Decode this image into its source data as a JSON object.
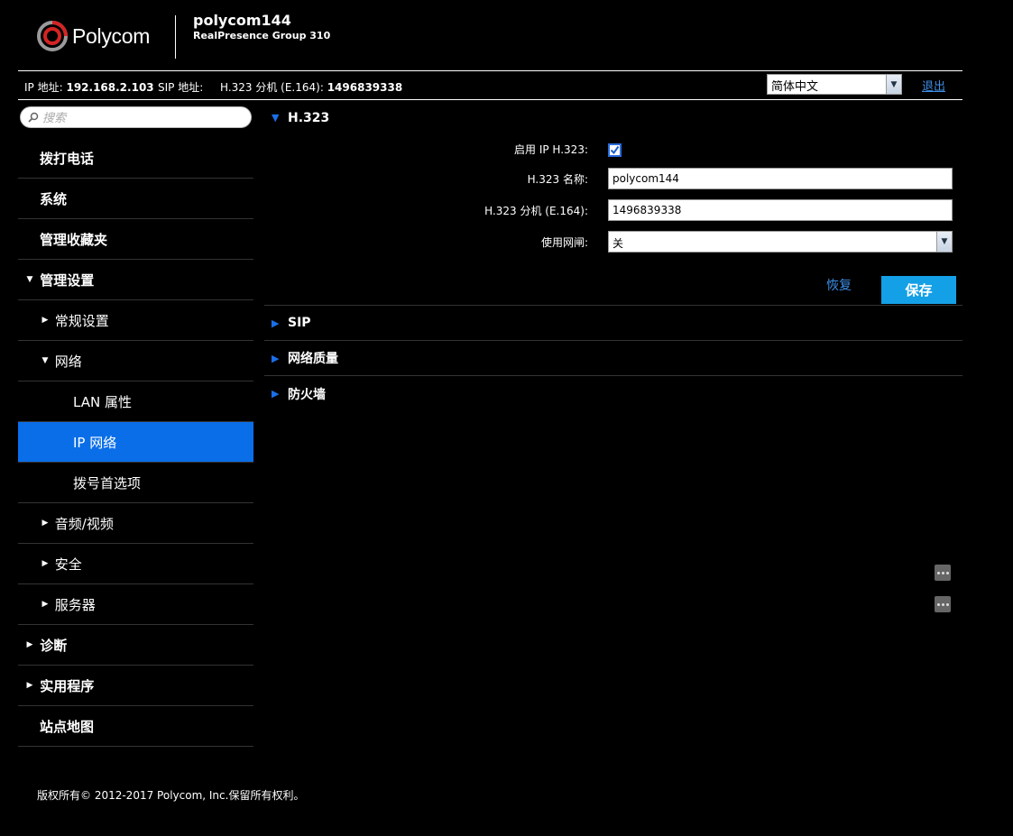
{
  "header": {
    "logo_text": "Polycom",
    "device_name": "polycom144",
    "device_model": "RealPresence Group 310"
  },
  "infobar": {
    "ip_label": "IP 地址:",
    "ip_value": "192.168.2.103",
    "sip_label": "SIP 地址:",
    "h323_label": "H.323 分机 (E.164):",
    "h323_value": "1496839338",
    "language": "简体中文",
    "logout": "退出"
  },
  "search": {
    "placeholder": "搜索"
  },
  "nav": {
    "dial": "拨打电话",
    "system": "系统",
    "favorites": "管理收藏夹",
    "admin": "管理设置",
    "general": "常规设置",
    "network": "网络",
    "lan": "LAN 属性",
    "ip_network": "IP 网络",
    "dialing_prefs": "拨号首选项",
    "audio_video": "音频/视频",
    "security": "安全",
    "servers": "服务器",
    "diagnostics": "诊断",
    "utilities": "实用程序",
    "sitemap": "站点地图"
  },
  "h323": {
    "title": "H.323",
    "enable_label": "启用 IP H.323:",
    "name_label": "H.323 名称:",
    "name_value": "polycom144",
    "ext_label": "H.323 分机 (E.164):",
    "ext_value": "1496839338",
    "gatekeeper_label": "使用网闸:",
    "gatekeeper_value": "关",
    "restore": "恢复",
    "save": "保存"
  },
  "sections": {
    "sip": "SIP",
    "qos": "网络质量",
    "firewall": "防火墙"
  },
  "footer": {
    "copyright": "版权所有© 2012-2017 Polycom, Inc.保留所有权利。"
  },
  "colors": {
    "accent": "#0a6ee8",
    "save_button": "#14a0e6",
    "link": "#3d8fe6"
  }
}
